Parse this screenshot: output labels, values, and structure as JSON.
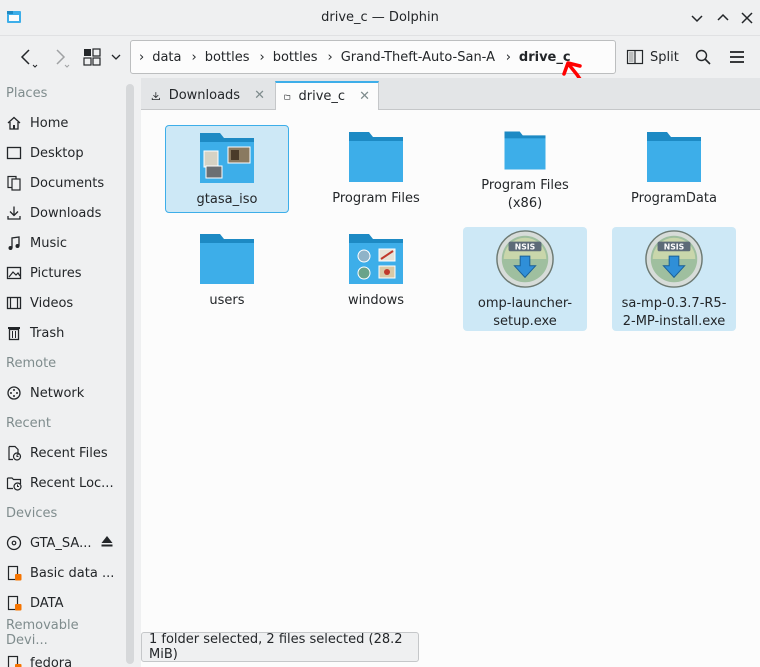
{
  "window": {
    "title": "drive_c — Dolphin"
  },
  "toolbar": {
    "breadcrumb": [
      "data",
      "bottles",
      "bottles",
      "Grand-Theft-Auto-San-Andreas",
      "drive_c"
    ],
    "split_label": "Split"
  },
  "sidebar": {
    "sections": {
      "places": "Places",
      "remote": "Remote",
      "recent": "Recent",
      "devices": "Devices",
      "removable": "Removable Devi..."
    },
    "places": [
      "Home",
      "Desktop",
      "Documents",
      "Downloads",
      "Music",
      "Pictures",
      "Videos",
      "Trash"
    ],
    "remote": [
      "Network"
    ],
    "recent": [
      "Recent Files",
      "Recent Loc..."
    ],
    "devices": [
      "GTA_SA...",
      "Basic data ...",
      "DATA"
    ],
    "removable": [
      "fedora"
    ]
  },
  "tabs": [
    "Downloads",
    "drive_c"
  ],
  "files": [
    {
      "name": "gtasa_iso",
      "kind": "folder-media",
      "state": "focused"
    },
    {
      "name": "Program Files",
      "kind": "folder",
      "state": ""
    },
    {
      "name": "Program Files (x86)",
      "kind": "folder",
      "state": ""
    },
    {
      "name": "ProgramData",
      "kind": "folder",
      "state": ""
    },
    {
      "name": "users",
      "kind": "folder",
      "state": ""
    },
    {
      "name": "windows",
      "kind": "folder-system",
      "state": ""
    },
    {
      "name": "omp-launcher-setup.exe",
      "kind": "nsis-installer",
      "state": "selected"
    },
    {
      "name": "sa-mp-0.3.7-R5-2-MP-install.exe",
      "kind": "nsis-installer",
      "state": "selected"
    }
  ],
  "icons": {
    "nsis_badge": "NSIS"
  },
  "status": {
    "text": "1 folder selected, 2 files selected (28.2 MiB)"
  },
  "colors": {
    "accent": "#3daee9",
    "folder": "#3daee9",
    "folder_dark": "#1d8ac4",
    "annotation": "#ff0000"
  }
}
